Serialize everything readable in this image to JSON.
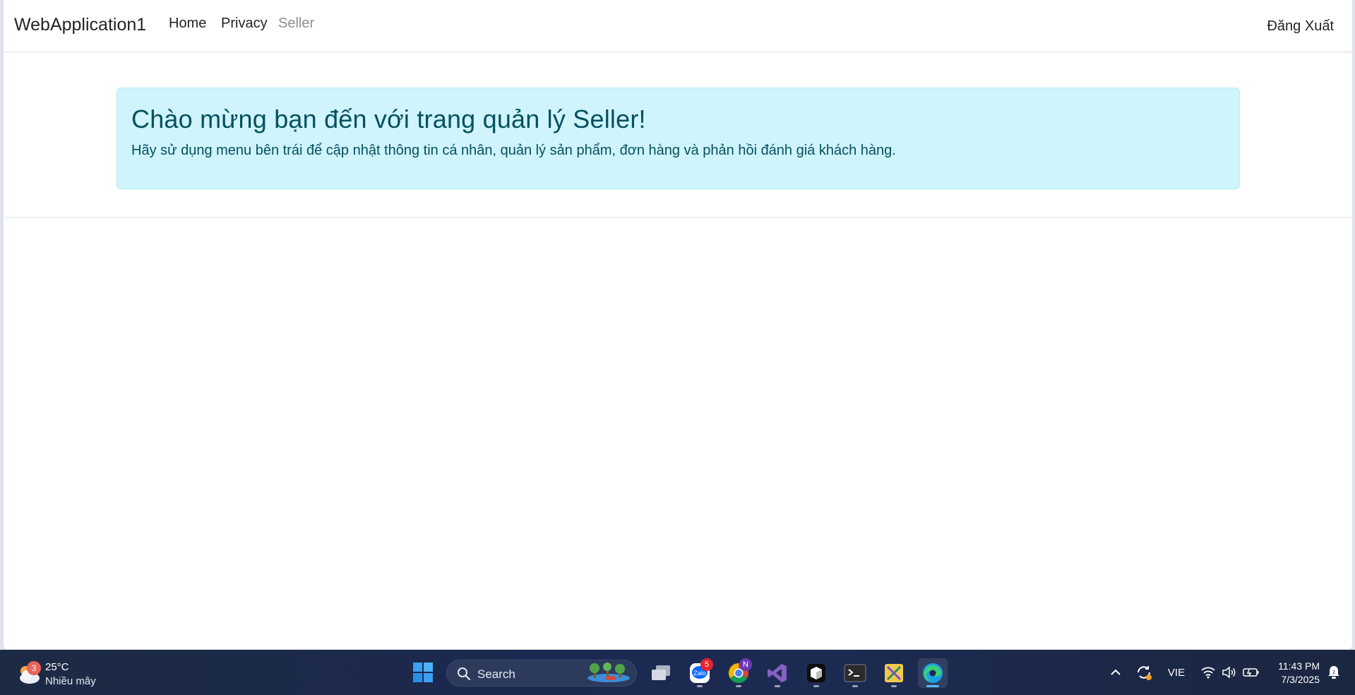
{
  "navbar": {
    "brand": "WebApplication1",
    "links": [
      {
        "label": "Home"
      },
      {
        "label": "Privacy"
      },
      {
        "label": "Seller"
      }
    ],
    "logout_label": "Đăng Xuất"
  },
  "alert": {
    "heading": "Chào mừng bạn đến với trang quản lý Seller!",
    "text": "Hãy sử dụng menu bên trái để cập nhật thông tin cá nhân, quản lý sản phẩm, đơn hàng và phản hồi đánh giá khách hàng."
  },
  "taskbar": {
    "weather": {
      "badge": "3",
      "temperature": "25°C",
      "condition": "Nhiều mây"
    },
    "search_placeholder": "Search",
    "apps": [
      {
        "name": "task-view-icon"
      },
      {
        "name": "zalo-icon",
        "badge": "5"
      },
      {
        "name": "chrome-icon",
        "badge": "N"
      },
      {
        "name": "visual-studio-icon"
      },
      {
        "name": "app-cube-icon"
      },
      {
        "name": "terminal-icon"
      },
      {
        "name": "snipping-tool-icon"
      },
      {
        "name": "edge-icon",
        "active": true
      }
    ],
    "tray": {
      "language": "VIE"
    },
    "clock": {
      "time": "11:43 PM",
      "date": "7/3/2025"
    }
  }
}
